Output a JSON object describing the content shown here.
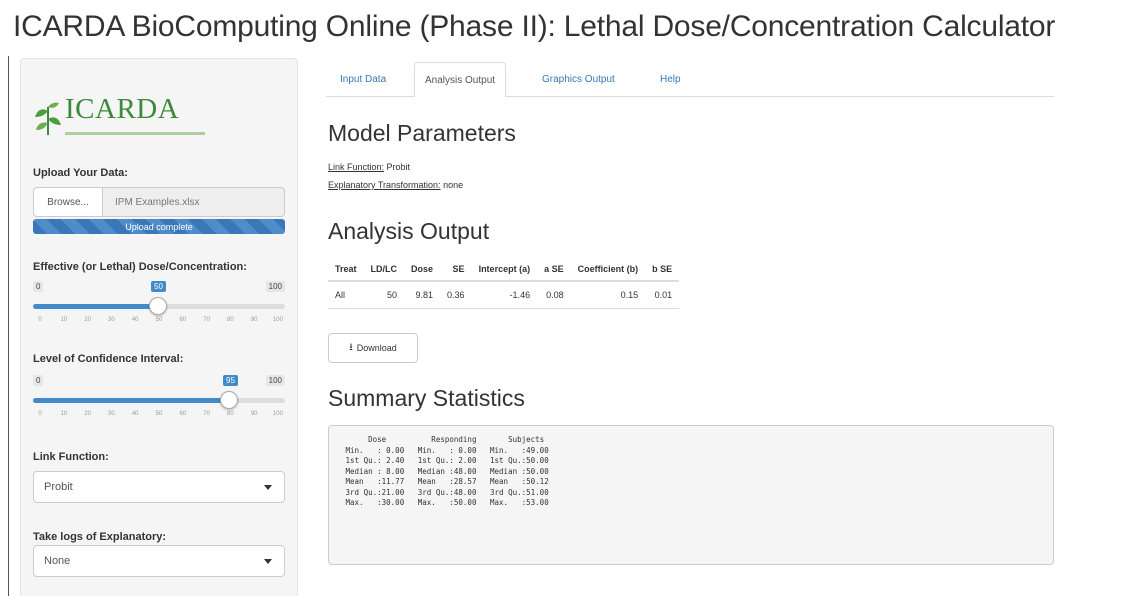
{
  "app": {
    "title": "ICARDA BioComputing Online (Phase II): Lethal Dose/Concentration Calculator"
  },
  "sidebar": {
    "logo_text": "ICARDA",
    "upload": {
      "label": "Upload Your Data:",
      "browse_label": "Browse...",
      "file_name": "IPM Examples.xlsx",
      "status": "Upload complete"
    },
    "dose_slider": {
      "label": "Effective (or Lethal) Dose/Concentration:",
      "min": "0",
      "max": "100",
      "value": "50",
      "ticks": [
        "0",
        "10",
        "20",
        "30",
        "40",
        "50",
        "60",
        "70",
        "80",
        "90",
        "100"
      ]
    },
    "ci_slider": {
      "label": "Level of Confidence Interval:",
      "min": "0",
      "max": "100",
      "value": "95",
      "ticks": [
        "0",
        "10",
        "20",
        "30",
        "40",
        "50",
        "60",
        "70",
        "80",
        "90",
        "100"
      ]
    },
    "link_function": {
      "label": "Link Function:",
      "selected": "Probit"
    },
    "logs": {
      "label": "Take logs of Explanatory:",
      "selected": "None"
    }
  },
  "tabs": [
    "Input Data",
    "Analysis Output",
    "Graphics Output",
    "Help"
  ],
  "main": {
    "model_params": {
      "heading": "Model Parameters",
      "link_key": "Link Function:",
      "link_value": "Probit",
      "transform_key": "Explanatory Transformation:",
      "transform_value": "none"
    },
    "analysis": {
      "heading": "Analysis Output",
      "columns": [
        "Treat",
        "LD/LC",
        "Dose",
        "SE",
        "Intercept (a)",
        "a SE",
        "Coefficient (b)",
        "b SE"
      ],
      "rows": [
        [
          "All",
          "50",
          "9.81",
          "0.36",
          "-1.46",
          "0.08",
          "0.15",
          "0.01"
        ]
      ],
      "download_label": "Download"
    },
    "summary": {
      "heading": "Summary Statistics",
      "text": "      Dose          Responding       Subjects    \n Min.   : 0.00   Min.   : 0.00   Min.   :49.00  \n 1st Qu.: 2.40   1st Qu.: 2.00   1st Qu.:50.00  \n Median : 8.00   Median :48.00   Median :50.00  \n Mean   :11.77   Mean   :28.57   Mean   :50.12  \n 3rd Qu.:21.00   3rd Qu.:48.00   3rd Qu.:51.00  \n Max.   :30.00   Max.   :50.00   Max.   :53.00  "
    }
  },
  "colors": {
    "primary": "#428bca",
    "logo_green": "#3a8a3a",
    "link": "#337ab7"
  }
}
